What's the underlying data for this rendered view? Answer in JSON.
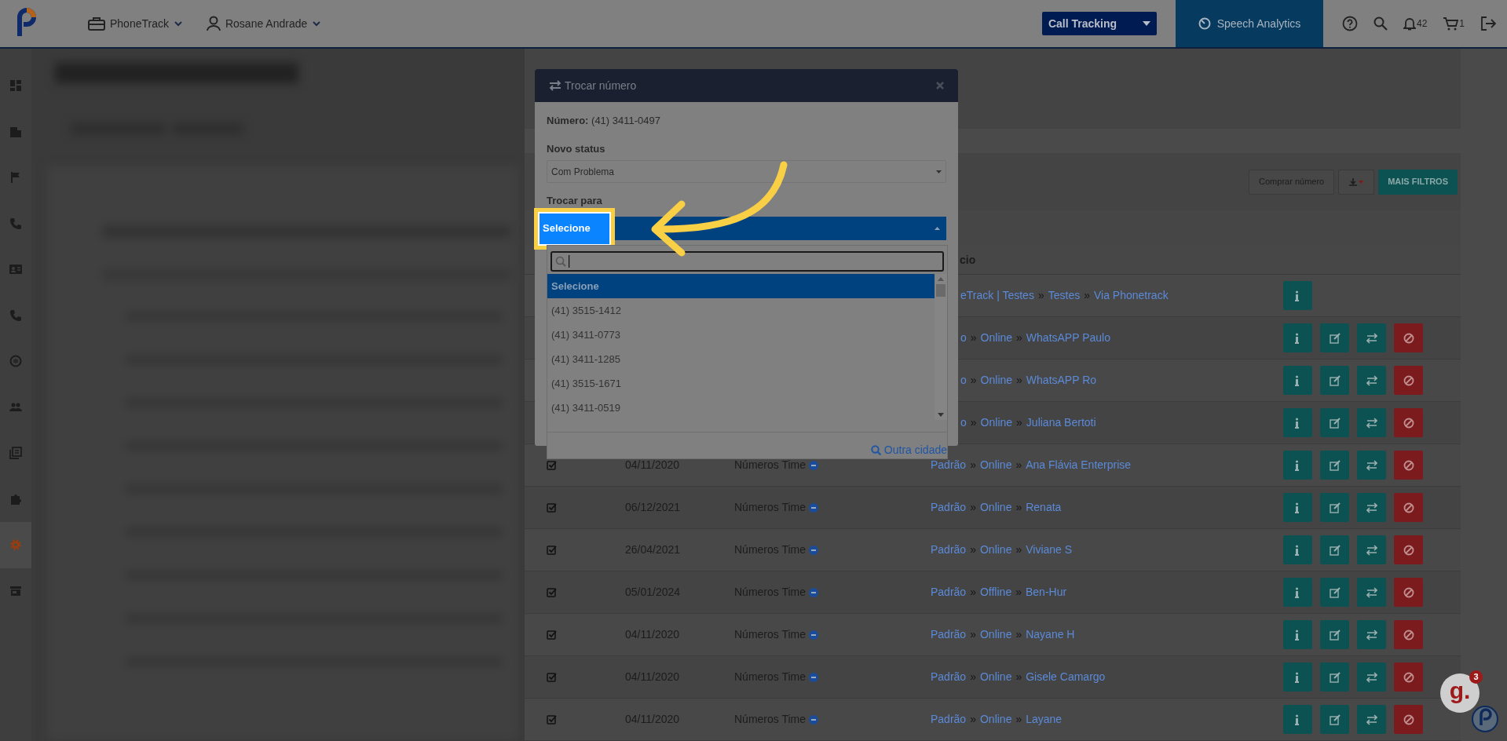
{
  "top_bar": {
    "company_menu": "PhoneTrack",
    "user_menu": "Rosane Andrade",
    "product_select": "Call Tracking",
    "speech_analytics": "Speech Analytics",
    "notifications_count": "42",
    "cart_count": "1"
  },
  "sidebar": {
    "items": [
      {
        "selected": false
      },
      {
        "selected": false
      },
      {
        "selected": false
      },
      {
        "selected": false
      },
      {
        "selected": false
      },
      {
        "selected": false
      },
      {
        "selected": false
      },
      {
        "selected": false
      },
      {
        "selected": false
      },
      {
        "selected": false
      },
      {
        "selected": true
      },
      {
        "selected": false
      }
    ]
  },
  "toolbar": {
    "buy_button": "Comprar número",
    "filters_button": "MAIS FILTROS"
  },
  "table": {
    "separator": "»",
    "column_header": "cio",
    "rows": [
      {
        "service": [
          "eTrack | Testes",
          "Testes",
          "Via Phonetrack"
        ],
        "buttons": [
          {
            "kind": "info"
          }
        ]
      },
      {
        "service": [
          "o",
          "Online",
          "WhatsAPP Paulo"
        ],
        "buttons": [
          {
            "kind": "info"
          },
          {
            "kind": "edit"
          },
          {
            "kind": "swap"
          },
          {
            "kind": "block"
          }
        ]
      },
      {
        "service": [
          "o",
          "Online",
          "WhatsAPP Ro"
        ],
        "buttons": [
          {
            "kind": "info"
          },
          {
            "kind": "edit"
          },
          {
            "kind": "swap"
          },
          {
            "kind": "block"
          }
        ]
      },
      {
        "service": [
          "o",
          "Online",
          "Juliana Bertoti"
        ],
        "buttons": [
          {
            "kind": "info"
          },
          {
            "kind": "edit"
          },
          {
            "kind": "swap"
          },
          {
            "kind": "block"
          }
        ]
      },
      {
        "checked": true,
        "date": "04/11/2020",
        "team": "Números Time",
        "service": [
          "Padrão",
          "Online",
          "Ana Flávia Enterprise"
        ],
        "buttons": [
          {
            "kind": "info"
          },
          {
            "kind": "edit"
          },
          {
            "kind": "swap"
          },
          {
            "kind": "block"
          }
        ]
      },
      {
        "checked": true,
        "date": "06/12/2021",
        "team": "Números Time",
        "service": [
          "Padrão",
          "Online",
          "Renata"
        ],
        "buttons": [
          {
            "kind": "info"
          },
          {
            "kind": "edit"
          },
          {
            "kind": "swap"
          },
          {
            "kind": "block"
          }
        ]
      },
      {
        "checked": true,
        "date": "26/04/2021",
        "team": "Números Time",
        "service": [
          "Padrão",
          "Online",
          "Viviane S"
        ],
        "buttons": [
          {
            "kind": "info"
          },
          {
            "kind": "edit"
          },
          {
            "kind": "swap"
          },
          {
            "kind": "block"
          }
        ]
      },
      {
        "checked": true,
        "date": "05/01/2024",
        "team": "Números Time",
        "service": [
          "Padrão",
          "Offline",
          "Ben-Hur"
        ],
        "buttons": [
          {
            "kind": "info"
          },
          {
            "kind": "edit"
          },
          {
            "kind": "swap"
          },
          {
            "kind": "block"
          }
        ]
      },
      {
        "checked": true,
        "date": "04/11/2020",
        "team": "Números Time",
        "service": [
          "Padrão",
          "Online",
          "Nayane H"
        ],
        "buttons": [
          {
            "kind": "info"
          },
          {
            "kind": "edit"
          },
          {
            "kind": "swap"
          },
          {
            "kind": "block"
          }
        ]
      },
      {
        "checked": true,
        "date": "04/11/2020",
        "team": "Números Time",
        "service": [
          "Padrão",
          "Online",
          "Gisele Camargo"
        ],
        "buttons": [
          {
            "kind": "info"
          },
          {
            "kind": "edit"
          },
          {
            "kind": "swap"
          },
          {
            "kind": "block"
          }
        ]
      },
      {
        "checked": true,
        "date": "04/11/2020",
        "team": "Números Time",
        "service": [
          "Padrão",
          "Online",
          "Layane"
        ],
        "buttons": [
          {
            "kind": "info"
          },
          {
            "kind": "edit"
          },
          {
            "kind": "swap"
          },
          {
            "kind": "block"
          }
        ]
      }
    ]
  },
  "modal": {
    "title": "Trocar número",
    "number": "**Número:** (41) 3411-0497",
    "status_label": "Novo status",
    "status_value": "Com Problema",
    "switch_label": "Trocar para",
    "switch_value": "Selecione",
    "options": [
      {
        "label": "Selecione",
        "selected": true
      },
      {
        "label": "(41) 3515-1412",
        "selected": false
      },
      {
        "label": "(41) 3411-0773",
        "selected": false
      },
      {
        "label": "(41) 3411-1285",
        "selected": false
      },
      {
        "label": "(41) 3515-1671",
        "selected": false
      },
      {
        "label": "(41) 3411-0519",
        "selected": false
      }
    ],
    "other_city_link": "Outra cidade"
  },
  "chat_widget": {
    "logo": "g.",
    "badge": "3"
  }
}
